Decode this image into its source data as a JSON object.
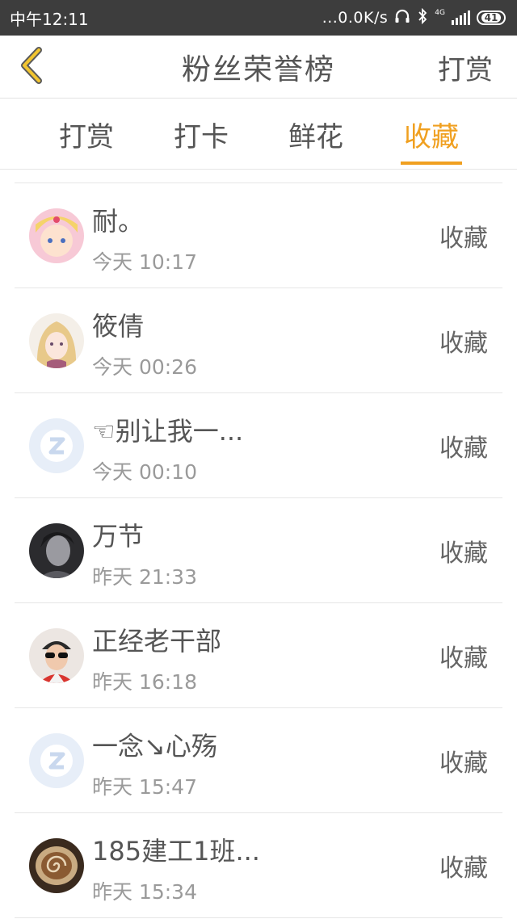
{
  "status_bar": {
    "time": "中午12:11",
    "network_speed": "...0.0K/s",
    "network_type": "4G",
    "battery": "41",
    "icons": [
      "headphones-icon",
      "bluetooth-icon",
      "signal-icon",
      "battery-icon"
    ]
  },
  "header": {
    "back_icon": "chevron-left-icon",
    "title": "粉丝荣誉榜",
    "right_action": "打赏"
  },
  "tabs": [
    {
      "label": "打赏",
      "active": false
    },
    {
      "label": "打卡",
      "active": false
    },
    {
      "label": "鲜花",
      "active": false
    },
    {
      "label": "收藏",
      "active": true
    }
  ],
  "accent_color": "#f0a020",
  "fans": [
    {
      "name": "耐。",
      "time": "今天 10:17",
      "action": "收藏"
    },
    {
      "name": "筱倩",
      "time": "今天 00:26",
      "action": "收藏"
    },
    {
      "name": "☜别让我一...",
      "time": "今天 00:10",
      "action": "收藏"
    },
    {
      "name": "万节",
      "time": "昨天 21:33",
      "action": "收藏"
    },
    {
      "name": "正经老干部",
      "time": "昨天 16:18",
      "action": "收藏"
    },
    {
      "name": "一念↘心殇",
      "time": "昨天 15:47",
      "action": "收藏"
    },
    {
      "name": "185建工1班...",
      "time": "昨天 15:34",
      "action": "收藏"
    }
  ]
}
